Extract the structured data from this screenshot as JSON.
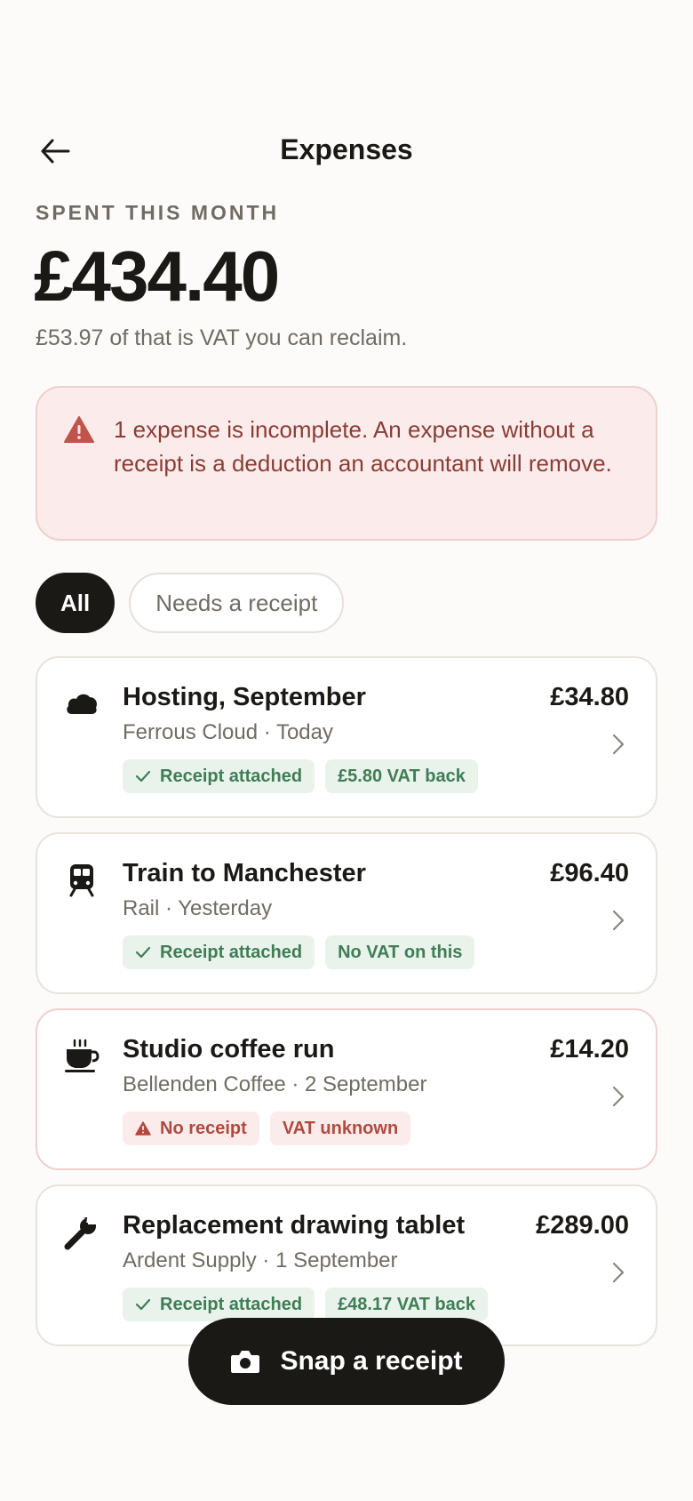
{
  "header": {
    "title": "Expenses"
  },
  "summary": {
    "label": "SPENT THIS MONTH",
    "amount": "£434.40",
    "vat_note": "£53.97 of that is VAT you can reclaim."
  },
  "alert": {
    "text": "1 expense is incomplete. An expense without a receipt is a deduction an accountant will remove."
  },
  "filters": [
    {
      "label": "All",
      "active": true
    },
    {
      "label": "Needs a receipt",
      "active": false
    }
  ],
  "expenses": [
    {
      "icon": "cloud-icon",
      "title": "Hosting, September",
      "subtitle": "Ferrous Cloud · Today",
      "amount": "£34.80",
      "badges": [
        {
          "label": "Receipt attached",
          "kind": "good"
        },
        {
          "label": "£5.80 VAT back",
          "kind": "good"
        }
      ]
    },
    {
      "icon": "train-icon",
      "title": "Train to Manchester",
      "subtitle": "Rail · Yesterday",
      "amount": "£96.40",
      "badges": [
        {
          "label": "Receipt attached",
          "kind": "good"
        },
        {
          "label": "No VAT on this",
          "kind": "good"
        }
      ]
    },
    {
      "icon": "coffee-cup-icon",
      "title": "Studio coffee run",
      "subtitle": "Bellenden Coffee · 2 September",
      "amount": "£14.20",
      "badges": [
        {
          "label": "No receipt",
          "kind": "bad"
        },
        {
          "label": "VAT unknown",
          "kind": "bad"
        }
      ]
    },
    {
      "icon": "wrench-icon",
      "title": "Replacement drawing tablet",
      "subtitle": "Ardent Supply · 1 September",
      "amount": "£289.00",
      "badges": [
        {
          "label": "Receipt attached",
          "kind": "good"
        },
        {
          "label": "£48.17 VAT back",
          "kind": "good"
        }
      ]
    }
  ],
  "fab": {
    "label": "Snap a receipt",
    "icon": "camera-icon"
  },
  "colors": {
    "background": "#fcfbf9",
    "ink": "#1b1916",
    "muted": "#716b64",
    "alert_bg": "#fbeceb",
    "alert_text": "#8a3d34",
    "good_bg": "#e9f3ec",
    "good_text": "#3f7d55",
    "bad_text": "#b04a3e"
  }
}
